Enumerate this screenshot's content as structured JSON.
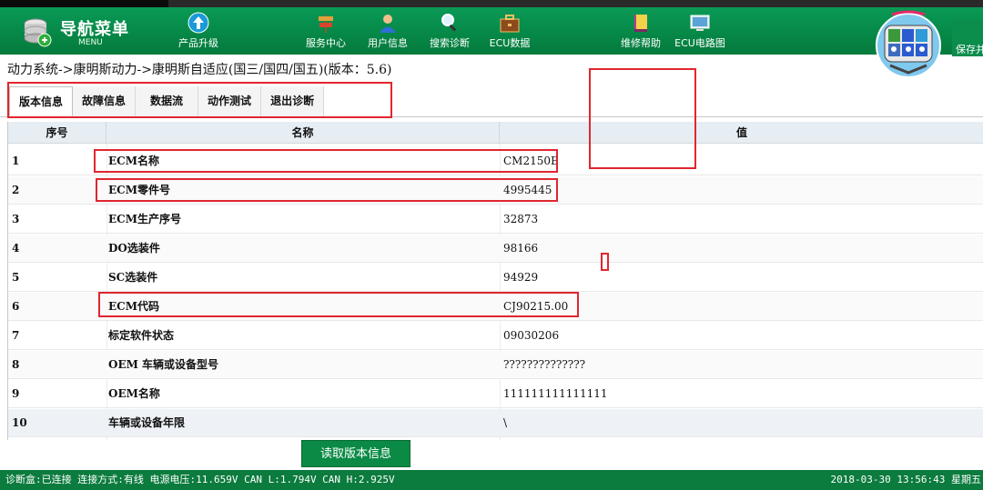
{
  "brand": {
    "title": "导航菜单",
    "subtitle": "MENU"
  },
  "nav": [
    {
      "label": "产品升级",
      "icon": "upgrade-icon"
    },
    {
      "label": "服务中心",
      "icon": "signpost-icon"
    },
    {
      "label": "用户信息",
      "icon": "user-icon"
    },
    {
      "label": "搜索诊断",
      "icon": "magnifier-icon"
    },
    {
      "label": "ECU数据",
      "icon": "briefcase-icon"
    },
    {
      "label": "维修帮助",
      "icon": "book-icon"
    },
    {
      "label": "ECU电路图",
      "icon": "monitor-icon"
    }
  ],
  "save_label": "保存并",
  "breadcrumb": "动力系统->康明斯动力->康明斯自适应(国三/国四/国五)(版本：5.6)",
  "tabs": [
    "版本信息",
    "故障信息",
    "数据流",
    "动作测试",
    "退出诊断"
  ],
  "table": {
    "headers": [
      "序号",
      "名称",
      "值"
    ],
    "rows": [
      {
        "no": "1",
        "name": "ECM名称",
        "value": "CM2150E"
      },
      {
        "no": "2",
        "name": "ECM零件号",
        "value": "4995445"
      },
      {
        "no": "3",
        "name": "ECM生产序号",
        "value": "32873"
      },
      {
        "no": "4",
        "name": "DO选装件",
        "value": "98166"
      },
      {
        "no": "5",
        "name": "SC选装件",
        "value": "94929"
      },
      {
        "no": "6",
        "name": "ECM代码",
        "value": "CJ90215.00"
      },
      {
        "no": "7",
        "name": "标定软件状态",
        "value": "09030206"
      },
      {
        "no": "8",
        "name": "OEM 车辆或设备型号",
        "value": "??????????????"
      },
      {
        "no": "9",
        "name": "OEM名称",
        "value": "111111111111111"
      },
      {
        "no": "10",
        "name": "车辆或设备年限",
        "value": "\\"
      }
    ]
  },
  "read_button": "读取版本信息",
  "status": {
    "left": "诊断盒:已连接 连接方式:有线 电源电压:11.659V  CAN L:1.794V  CAN H:2.925V",
    "right": "2018-03-30 13:56:43 星期五"
  },
  "colors": {
    "primary_green": "#0b8a45",
    "highlight_red": "#e0262f"
  }
}
